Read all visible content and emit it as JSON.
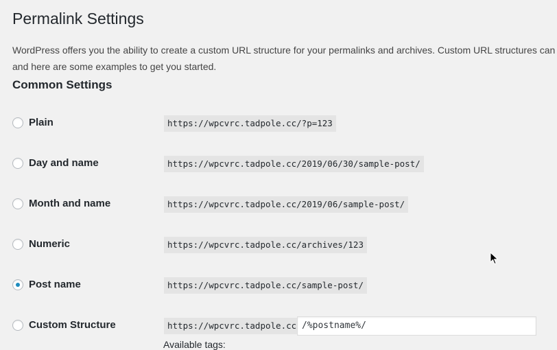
{
  "page": {
    "title": "Permalink Settings",
    "intro_line1": "WordPress offers you the ability to create a custom URL structure for your permalinks and archives. Custom URL structures can imp",
    "intro_line2": "and here are some examples to get you started.",
    "section_title": "Common Settings"
  },
  "options": [
    {
      "label": "Plain",
      "example": "https://wpcvrc.tadpole.cc/?p=123",
      "checked": false
    },
    {
      "label": "Day and name",
      "example": "https://wpcvrc.tadpole.cc/2019/06/30/sample-post/",
      "checked": false
    },
    {
      "label": "Month and name",
      "example": "https://wpcvrc.tadpole.cc/2019/06/sample-post/",
      "checked": false
    },
    {
      "label": "Numeric",
      "example": "https://wpcvrc.tadpole.cc/archives/123",
      "checked": false
    },
    {
      "label": "Post name",
      "example": "https://wpcvrc.tadpole.cc/sample-post/",
      "checked": true
    },
    {
      "label": "Custom Structure",
      "example": "https://wpcvrc.tadpole.cc",
      "checked": false
    }
  ],
  "custom_structure": {
    "value": "/%postname%/"
  },
  "available_tags_label": "Available tags:",
  "colors": {
    "radio_checked": "#1e8cbe",
    "background": "#f1f1f1",
    "code_background": "#e4e4e4"
  }
}
